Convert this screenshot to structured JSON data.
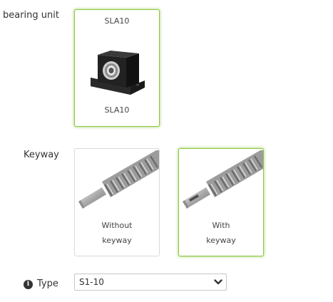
{
  "bearing_unit": {
    "label": "bearing unit",
    "option": {
      "top_label": "SLA10",
      "bottom_label": "SLA10",
      "selected": true,
      "image_icon": "bearing-block-image"
    }
  },
  "keyway": {
    "label": "Keyway",
    "options": [
      {
        "line1": "Without",
        "line2": "keyway",
        "selected": false,
        "image_icon": "ball-screw-without-keyway-image"
      },
      {
        "line1": "With",
        "line2": "keyway",
        "selected": true,
        "image_icon": "ball-screw-with-keyway-image"
      }
    ]
  },
  "type": {
    "label": "Type",
    "info_icon": "info-icon",
    "selected_value": "S1-10"
  },
  "colors": {
    "selected_border": "#8cc63f",
    "card_border": "#d9d9d9",
    "text": "#333333"
  }
}
